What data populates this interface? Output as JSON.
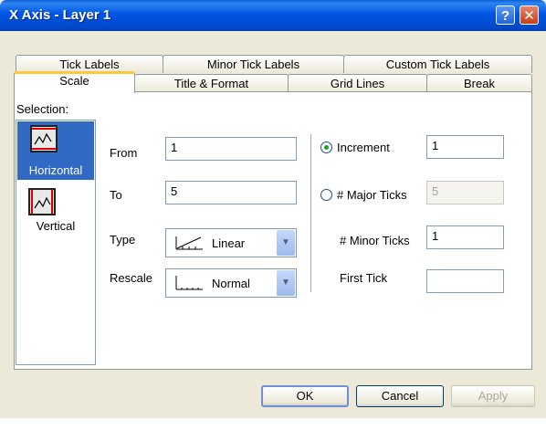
{
  "window": {
    "title": "X Axis - Layer 1",
    "help_glyph": "?",
    "close_glyph": "✕"
  },
  "tabs_row1": [
    "Tick Labels",
    "Minor Tick Labels",
    "Custom Tick Labels"
  ],
  "tabs_row2": [
    "Scale",
    "Title & Format",
    "Grid Lines",
    "Break"
  ],
  "active_tab": "Scale",
  "selection": {
    "label": "Selection:",
    "items": [
      {
        "label": "Horizontal",
        "selected": true
      },
      {
        "label": "Vertical",
        "selected": false
      }
    ]
  },
  "scale": {
    "from_label": "From",
    "from_value": "1",
    "to_label": "To",
    "to_value": "5",
    "type_label": "Type",
    "type_value": "Linear",
    "rescale_label": "Rescale",
    "rescale_value": "Normal"
  },
  "ticks": {
    "increment_label": "Increment",
    "increment_value": "1",
    "increment_checked": true,
    "major_label": "# Major Ticks",
    "major_value": "5",
    "major_checked": false,
    "minor_label": "# Minor Ticks",
    "minor_value": "1",
    "first_label": "First Tick",
    "first_value": ""
  },
  "buttons": {
    "ok": "OK",
    "cancel": "Cancel",
    "apply": "Apply"
  },
  "colors": {
    "titlebar": "#0055e5",
    "selection_highlight": "#316ac5",
    "active_tab_accent": "#ffc83c"
  }
}
